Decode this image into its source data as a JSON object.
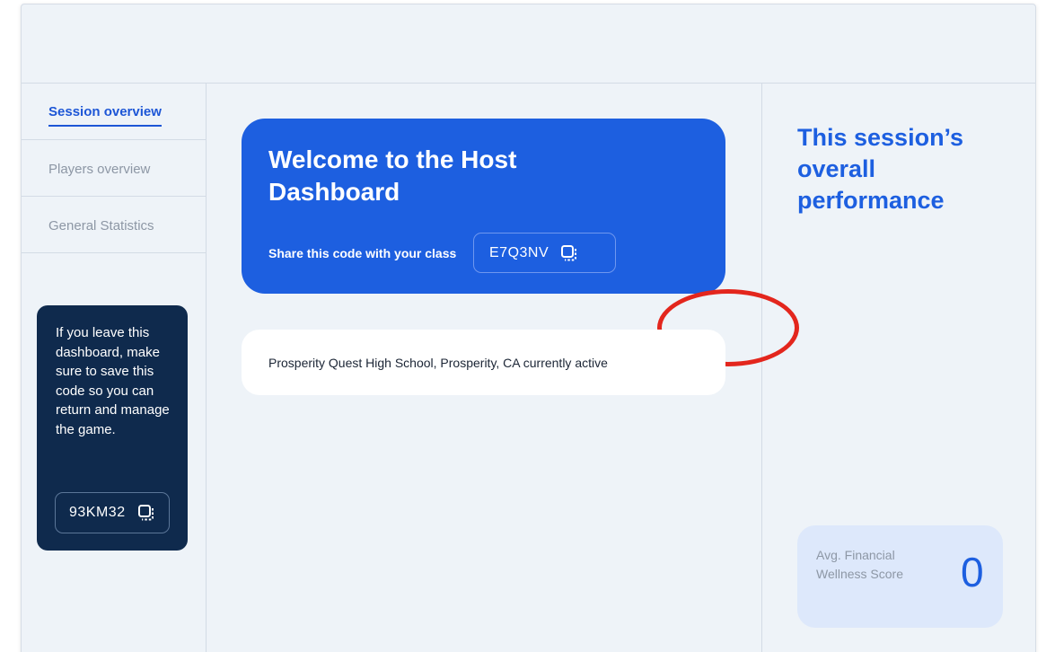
{
  "sidebar": {
    "items": [
      {
        "label": "Session overview",
        "active": true
      },
      {
        "label": "Players overview",
        "active": false
      },
      {
        "label": "General Statistics",
        "active": false
      }
    ],
    "notice": {
      "text": "If you leave this dashboard, make sure to save this code so you can return and manage the game.",
      "code": "93KM32",
      "icon": "copy-icon"
    }
  },
  "main": {
    "welcome": {
      "title": "Welcome to the Host Dashboard",
      "share_label": "Share this code with your class",
      "code": "E7Q3NV",
      "icon": "copy-icon"
    },
    "school_status": "Prosperity Quest High School, Prosperity, CA currently active"
  },
  "right": {
    "title": "This session’s overall performance",
    "score_card": {
      "label": "Avg. Financial Wellness Score",
      "value": "0"
    }
  },
  "colors": {
    "accent": "#1d5fe0",
    "notice_bg": "#0f2a4d",
    "page_bg": "#eef3f8",
    "score_bg": "#dde8fb",
    "annotation_ring": "#e3261d"
  }
}
